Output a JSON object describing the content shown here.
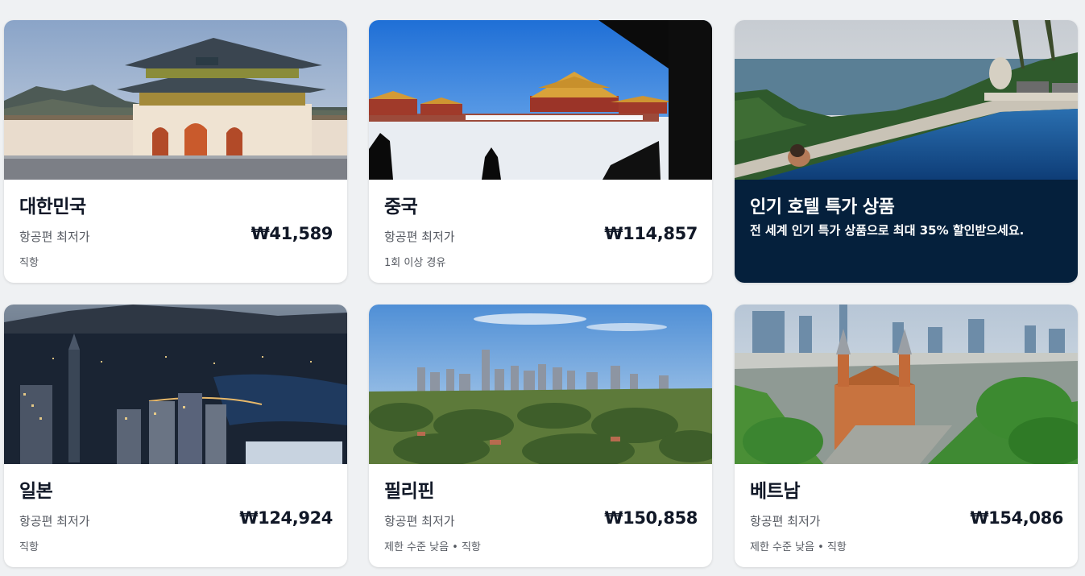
{
  "cards": [
    {
      "title": "대한민국",
      "price_label": "항공편 최저가",
      "price": "₩41,589",
      "note": "직항",
      "image": "gyeongbokgung-palace-photo"
    },
    {
      "title": "중국",
      "price_label": "항공편 최저가",
      "price": "₩114,857",
      "note": "1회 이상 경유",
      "image": "forbidden-city-snow-photo"
    },
    {
      "title": "인기 호텔 특가 상품",
      "description": "전 세계 인기 특가 상품으로 최대 35% 할인받으세요.",
      "image": "infinity-pool-ocean-photo",
      "background": "#05203c"
    },
    {
      "title": "일본",
      "price_label": "항공편 최저가",
      "price": "₩124,924",
      "note": "직항",
      "image": "yokohama-night-city-photo"
    },
    {
      "title": "필리핀",
      "price_label": "항공편 최저가",
      "price": "₩150,858",
      "note": "제한 수준 낮음 • 직항",
      "image": "manila-skyline-greenery-photo"
    },
    {
      "title": "베트남",
      "price_label": "항공편 최저가",
      "price": "₩154,086",
      "note": "제한 수준 낮음 • 직항",
      "image": "saigon-cathedral-city-photo"
    }
  ],
  "colors": {
    "page_background": "#eff1f3",
    "card_background": "#ffffff",
    "promo_background": "#05203c",
    "text_primary": "#111827",
    "text_secondary": "#545860"
  }
}
